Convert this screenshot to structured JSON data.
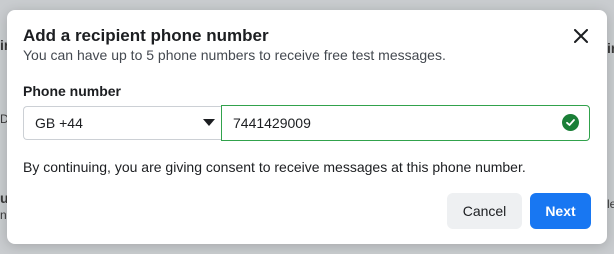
{
  "dialog": {
    "title": "Add a recipient phone number",
    "subtitle": "You can have up to 5 phone numbers to receive free test messages.",
    "field_label": "Phone number",
    "country_code": "GB +44",
    "phone_value": "7441429009",
    "consent_text": "By continuing, you are giving consent to receive messages at this phone number.",
    "cancel_label": "Cancel",
    "next_label": "Next"
  },
  "colors": {
    "primary": "#1877f2",
    "success": "#1a7f37",
    "valid_border": "#31a24c"
  },
  "icons": [
    "close-icon",
    "chevron-down-icon",
    "check-circle-icon"
  ]
}
